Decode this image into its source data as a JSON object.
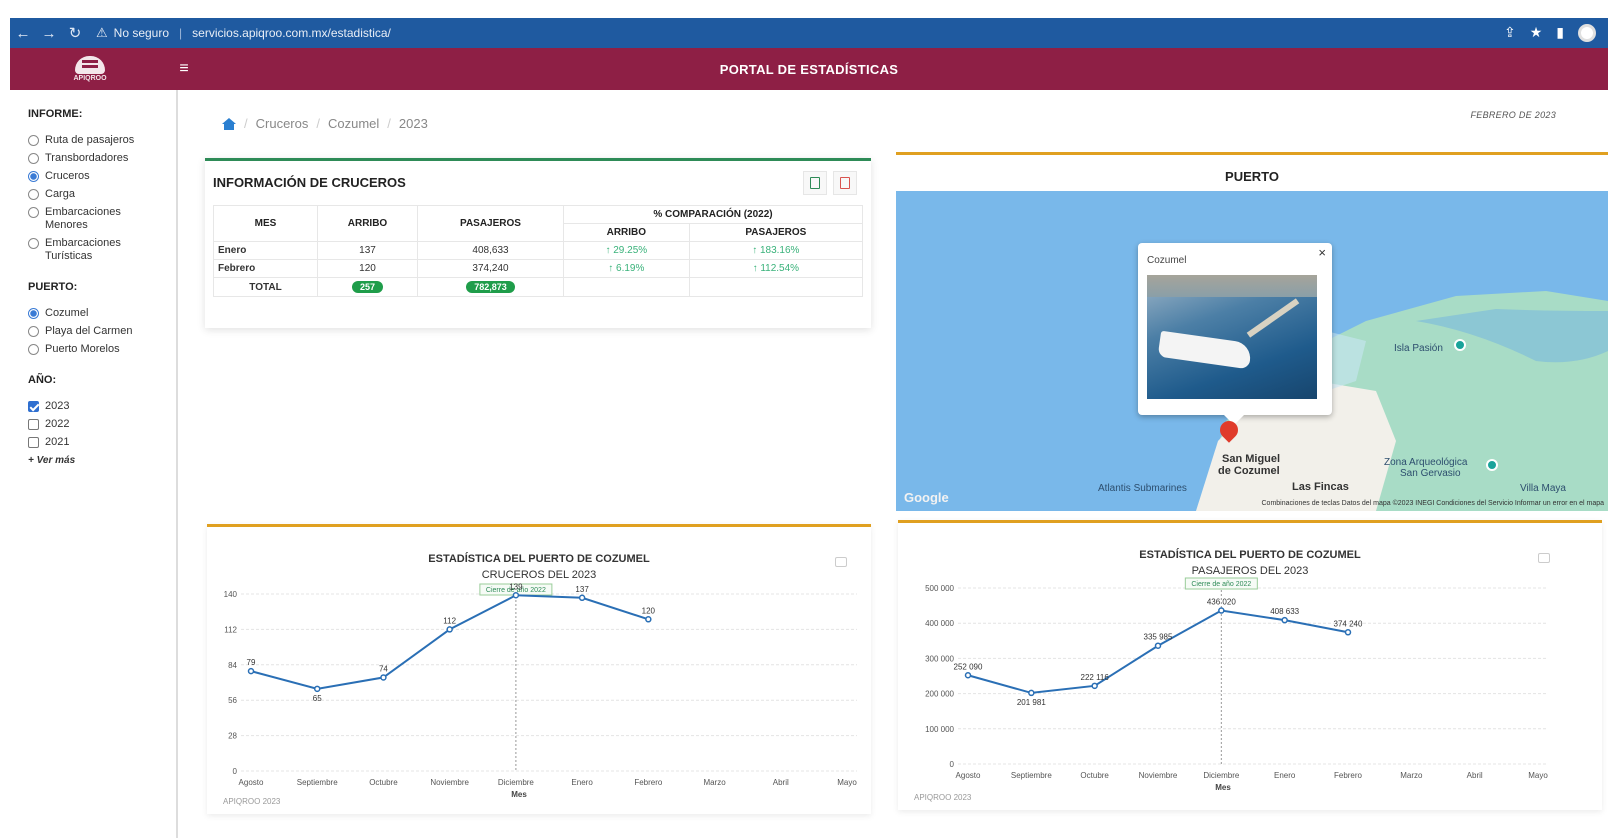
{
  "browser": {
    "security_label": "No seguro",
    "url": "servicios.apiqroo.com.mx/estadistica/"
  },
  "header": {
    "logo_text": "APIQROO",
    "title": "PORTAL DE ESTADÍSTICAS"
  },
  "sidebar": {
    "informe_label": "INFORME:",
    "informe_options": [
      {
        "label": "Ruta de pasajeros",
        "checked": false
      },
      {
        "label": "Transbordadores",
        "checked": false
      },
      {
        "label": "Cruceros",
        "checked": true
      },
      {
        "label": "Carga",
        "checked": false
      },
      {
        "label": "Embarcaciones Menores",
        "checked": false
      },
      {
        "label": "Embarcaciones Turísticas",
        "checked": false
      }
    ],
    "puerto_label": "PUERTO:",
    "puerto_options": [
      {
        "label": "Cozumel",
        "checked": true
      },
      {
        "label": "Playa del Carmen",
        "checked": false
      },
      {
        "label": "Puerto Morelos",
        "checked": false
      }
    ],
    "anio_label": "AÑO:",
    "anio_options": [
      {
        "label": "2023",
        "checked": true
      },
      {
        "label": "2022",
        "checked": false
      },
      {
        "label": "2021",
        "checked": false
      }
    ],
    "more_label": "+ Ver más"
  },
  "breadcrumb": {
    "items": [
      "Cruceros",
      "Cozumel",
      "2023"
    ]
  },
  "date_label": "FEBRERO DE 2023",
  "info": {
    "title": "INFORMACIÓN DE CRUCEROS",
    "headers": {
      "mes": "MES",
      "arribo": "ARRIBO",
      "pasajeros": "PASAJEROS",
      "comparacion": "% COMPARACIÓN (2022)",
      "comp_arribo": "ARRIBO",
      "comp_pasajeros": "PASAJEROS"
    },
    "rows": [
      {
        "mes": "Enero",
        "arribo": "137",
        "pasajeros": "408,633",
        "comp_arribo": "↑ 29.25%",
        "comp_pasajeros": "↑ 183.16%"
      },
      {
        "mes": "Febrero",
        "arribo": "120",
        "pasajeros": "374,240",
        "comp_arribo": "↑ 6.19%",
        "comp_pasajeros": "↑ 112.54%"
      }
    ],
    "total_label": "TOTAL",
    "total_arribo": "257",
    "total_pasajeros": "782,873",
    "colors": {
      "accent": "#2e8b57",
      "up": "#39b27a",
      "pill": "#1f9d4a"
    }
  },
  "puerto": {
    "title": "PUERTO",
    "popup_title": "Cozumel",
    "labels": {
      "isla": "Isla Pasión",
      "san_miguel_1": "San Miguel",
      "san_miguel_2": "de Cozumel",
      "zona_1": "Zona Arqueológica",
      "zona_2": "San Gervasio",
      "atlantis": "Atlantis Submarines",
      "fincas": "Las Fincas",
      "villa": "Villa Maya",
      "google": "Google"
    },
    "footer": "Combinaciones de teclas   Datos del mapa ©2023 INEGI   Condiciones del Servicio   Informar un error en el mapa"
  },
  "chart_data": [
    {
      "type": "line",
      "title": "ESTADÍSTICA DEL PUERTO DE COZUMEL",
      "subtitle": "CRUCEROS DEL 2023",
      "xlabel": "Mes",
      "ylabel": "",
      "categories": [
        "Agosto",
        "Septiembre",
        "Octubre",
        "Noviembre",
        "Diciembre",
        "Enero",
        "Febrero",
        "Marzo",
        "Abril",
        "Mayo"
      ],
      "values": [
        79,
        65,
        74,
        112,
        139,
        137,
        120,
        null,
        null,
        null
      ],
      "value_labels": [
        "79",
        "65",
        "74",
        "112",
        "139",
        "137",
        "120"
      ],
      "yticks": [
        0,
        28,
        56,
        84,
        112,
        140
      ],
      "ytick_labels": [
        "0",
        "28",
        "56",
        "84",
        "112",
        "140"
      ],
      "ylim": [
        0,
        140
      ],
      "plot_line": {
        "category": "Diciembre",
        "label": "Cierre de año 2022"
      },
      "credit": "APIQROO 2023",
      "line_color": "#2a6fb5",
      "grid": true
    },
    {
      "type": "line",
      "title": "ESTADÍSTICA DEL PUERTO DE COZUMEL",
      "subtitle": "PASAJEROS DEL 2023",
      "xlabel": "Mes",
      "ylabel": "",
      "categories": [
        "Agosto",
        "Septiembre",
        "Octubre",
        "Noviembre",
        "Diciembre",
        "Enero",
        "Febrero",
        "Marzo",
        "Abril",
        "Mayo"
      ],
      "values": [
        252090,
        201981,
        222116,
        335985,
        436020,
        408633,
        374240,
        null,
        null,
        null
      ],
      "value_labels": [
        "252 090",
        "201 981",
        "222 116",
        "335 985",
        "436 020",
        "408 633",
        "374 240"
      ],
      "yticks": [
        0,
        100000,
        200000,
        300000,
        400000,
        500000
      ],
      "ytick_labels": [
        "0",
        "100 000",
        "200 000",
        "300 000",
        "400 000",
        "500 000"
      ],
      "ylim": [
        0,
        500000
      ],
      "plot_line": {
        "category": "Diciembre",
        "label": "Cierre de año 2022"
      },
      "credit": "APIQROO 2023",
      "line_color": "#2a6fb5",
      "grid": true
    }
  ]
}
